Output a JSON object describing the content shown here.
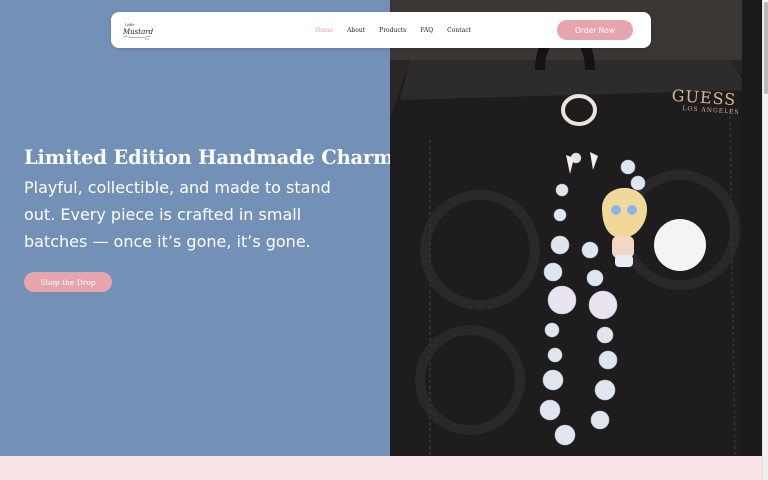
{
  "nav": {
    "logo_text": "Mustard",
    "links": [
      "Home",
      "About",
      "Products",
      "FAQ",
      "Contact"
    ],
    "active_link": "Home",
    "order_label": "Order Now"
  },
  "hero": {
    "title": "Limited Edition Handmade Charms",
    "text": "Playful, collectible, and made to stand out. Every piece is crafted in small batches — once it’s gone, it’s gone.",
    "cta_label": "Shop the Drop"
  },
  "photo": {
    "brand": "GUESS",
    "brand_sub": "LOS ANGELES"
  },
  "colors": {
    "hero_bg": "#7390b7",
    "accent": "#e6a5ad",
    "active_link": "#e4a3ad",
    "bottom_band": "#f9e3e7"
  },
  "icons": [
    "logo-mark"
  ]
}
